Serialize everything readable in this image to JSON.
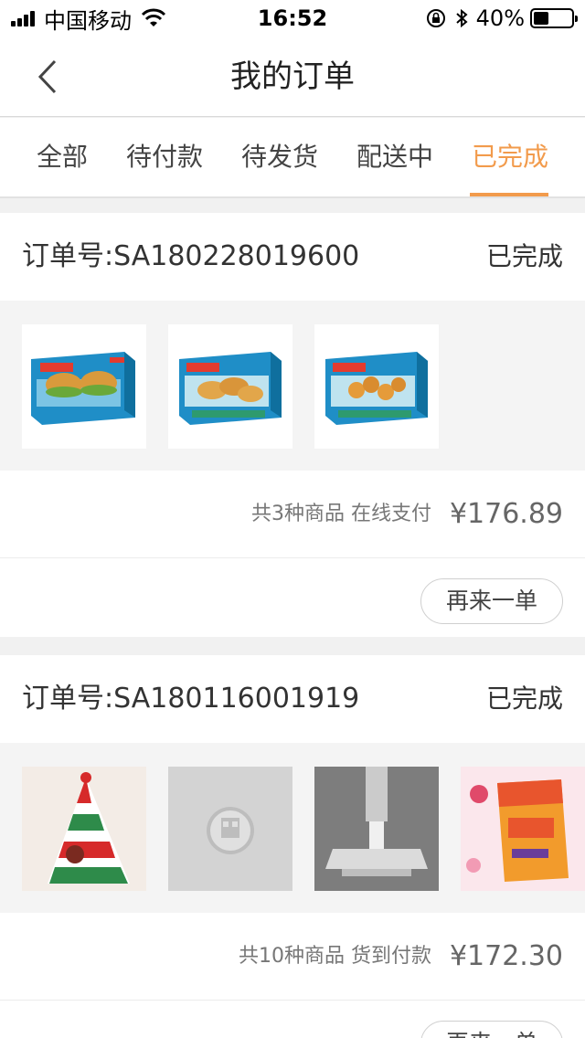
{
  "status_bar": {
    "carrier": "中国移动",
    "time": "16:52",
    "battery_percent": "40%",
    "battery_level": 0.4,
    "icons": [
      "signal-icon",
      "wifi-icon",
      "rotation-lock-icon",
      "bluetooth-icon",
      "battery-icon"
    ]
  },
  "nav": {
    "back_icon": "chevron-left-icon",
    "title": "我的订单"
  },
  "tabs": [
    {
      "label": "全部",
      "active": false
    },
    {
      "label": "待付款",
      "active": false
    },
    {
      "label": "待发货",
      "active": false
    },
    {
      "label": "配送中",
      "active": false
    },
    {
      "label": "已完成",
      "active": true
    }
  ],
  "colors": {
    "accent": "#f29b4c",
    "background": "#f1f1f1"
  },
  "orders": [
    {
      "order_no": "订单号:SA180228019600",
      "status": "已完成",
      "summary": "共3种商品 在线支付",
      "total": "¥176.89",
      "button": "再来一单",
      "goods_images": [
        "fish-burger-box-image",
        "fish-fillet-box-image",
        "shrimp-box-image"
      ]
    },
    {
      "order_no": "订单号:SA180116001919",
      "status": "已完成",
      "summary": "共10种商品 货到付款",
      "total": "¥172.30",
      "button": "再来一单",
      "goods_images": [
        "christmas-hat-image",
        "placeholder-image",
        "clip-holder-image",
        "snack-box-image"
      ]
    }
  ]
}
